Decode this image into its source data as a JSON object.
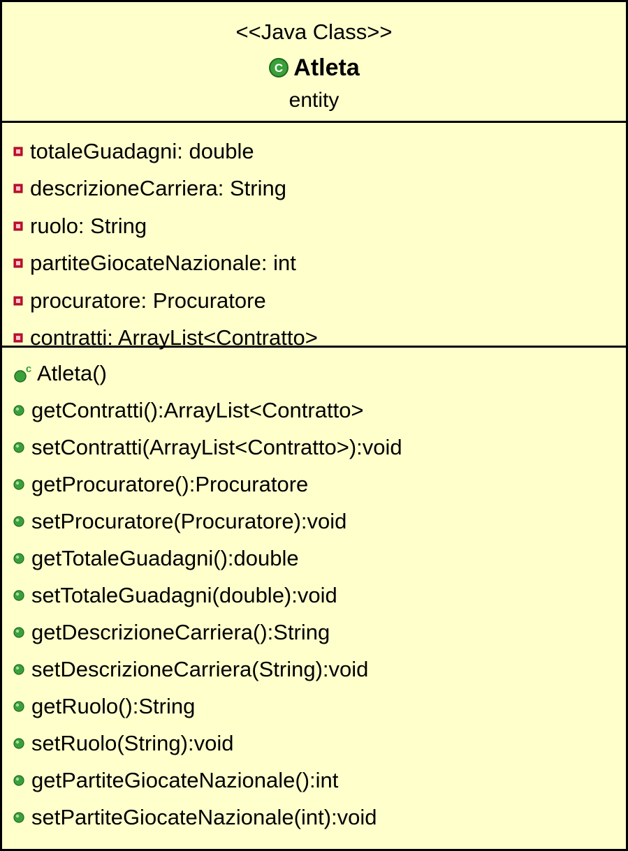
{
  "class": {
    "stereotype": "<<Java Class>>",
    "name": "Atleta",
    "package": "entity",
    "icon": "class-icon"
  },
  "attributes": [
    {
      "text": "totaleGuadagni: double",
      "icon": "private-field-icon"
    },
    {
      "text": "descrizioneCarriera: String",
      "icon": "private-field-icon"
    },
    {
      "text": "ruolo: String",
      "icon": "private-field-icon"
    },
    {
      "text": "partiteGiocateNazionale: int",
      "icon": "private-field-icon"
    },
    {
      "text": "procuratore: Procuratore",
      "icon": "private-field-icon"
    },
    {
      "text": "contratti: ArrayList<Contratto>",
      "icon": "private-field-icon"
    }
  ],
  "operations": [
    {
      "text": "Atleta()",
      "icon": "constructor-icon"
    },
    {
      "text": "getContratti():ArrayList<Contratto>",
      "icon": "public-method-icon"
    },
    {
      "text": "setContratti(ArrayList<Contratto>):void",
      "icon": "public-method-icon"
    },
    {
      "text": "getProcuratore():Procuratore",
      "icon": "public-method-icon"
    },
    {
      "text": "setProcuratore(Procuratore):void",
      "icon": "public-method-icon"
    },
    {
      "text": "getTotaleGuadagni():double",
      "icon": "public-method-icon"
    },
    {
      "text": "setTotaleGuadagni(double):void",
      "icon": "public-method-icon"
    },
    {
      "text": "getDescrizioneCarriera():String",
      "icon": "public-method-icon"
    },
    {
      "text": "setDescrizioneCarriera(String):void",
      "icon": "public-method-icon"
    },
    {
      "text": "getRuolo():String",
      "icon": "public-method-icon"
    },
    {
      "text": "setRuolo(String):void",
      "icon": "public-method-icon"
    },
    {
      "text": "getPartiteGiocateNazionale():int",
      "icon": "public-method-icon"
    },
    {
      "text": "setPartiteGiocateNazionale(int):void",
      "icon": "public-method-icon"
    }
  ],
  "colors": {
    "background": "#ffffcc",
    "border": "#000000",
    "private_icon": "#c8102e",
    "public_icon": "#3aa13a"
  }
}
